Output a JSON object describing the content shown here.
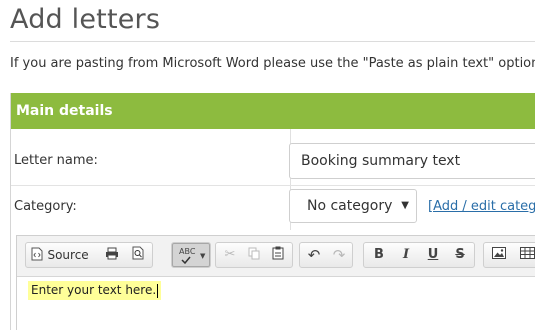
{
  "page": {
    "title": "Add letters",
    "notice": "If you are pasting from Microsoft Word please use the \"Paste as plain text\" option."
  },
  "panel": {
    "header": "Main details",
    "letter_name": {
      "label": "Letter name:",
      "value": "Booking summary text"
    },
    "category": {
      "label": "Category:",
      "selected": "No category",
      "link": "[Add / edit catego"
    }
  },
  "editor": {
    "toolbar": {
      "source_label": "Source",
      "icons": [
        "source-icon",
        "print-icon",
        "preview-icon",
        "spellcheck-icon",
        "cut-icon",
        "copy-icon",
        "paste-icon",
        "undo-icon",
        "redo-icon",
        "bold-icon",
        "italic-icon",
        "underline-icon",
        "strikethrough-icon",
        "image-icon",
        "table-icon"
      ],
      "bold": "B",
      "italic": "I",
      "underline": "U",
      "strike": "S",
      "spellcheck": "ABC"
    },
    "content": "Enter your text here."
  },
  "colors": {
    "header_green": "#8dbb3f",
    "link_blue": "#2a6ea8",
    "highlight_yellow": "#ffff99"
  }
}
